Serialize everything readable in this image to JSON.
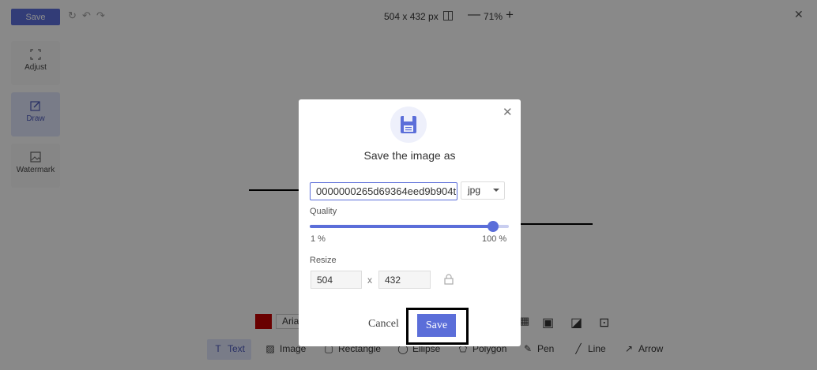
{
  "topbar": {
    "save_label": "Save",
    "dimensions": "504 x 432 px",
    "zoom_level": "71%",
    "zoom_out": "—",
    "zoom_in": "+",
    "close": "✕"
  },
  "sidebar": {
    "items": [
      {
        "label": "Adjust",
        "icon": "crop-icon"
      },
      {
        "label": "Draw",
        "icon": "edit-icon"
      },
      {
        "label": "Watermark",
        "icon": "image-icon"
      }
    ]
  },
  "bottom_toolbar": {
    "font": "Aria",
    "color": "#c00000",
    "tools": [
      {
        "label": "Text",
        "glyph": "T"
      },
      {
        "label": "Image",
        "glyph": "▨"
      },
      {
        "label": "Rectangle",
        "glyph": "▢"
      },
      {
        "label": "Ellipse",
        "glyph": "◯"
      },
      {
        "label": "Polygon",
        "glyph": "⬠"
      },
      {
        "label": "Pen",
        "glyph": "✎"
      },
      {
        "label": "Line",
        "glyph": "╱"
      },
      {
        "label": "Arrow",
        "glyph": "↗"
      }
    ]
  },
  "dialog": {
    "title": "Save the image as",
    "filename": "0000000265d69364eed9b904t",
    "format": "jpg",
    "quality_label": "Quality",
    "quality_value": 1.0,
    "quality_min_label": "1 %",
    "quality_max_label": "100 %",
    "resize_label": "Resize",
    "width": "504",
    "height": "432",
    "separator": "x",
    "cancel_label": "Cancel",
    "save_label": "Save",
    "close": "✕"
  },
  "colors": {
    "accent": "#5b6ed9",
    "overlay": "rgba(0,0,0,0.45)"
  }
}
